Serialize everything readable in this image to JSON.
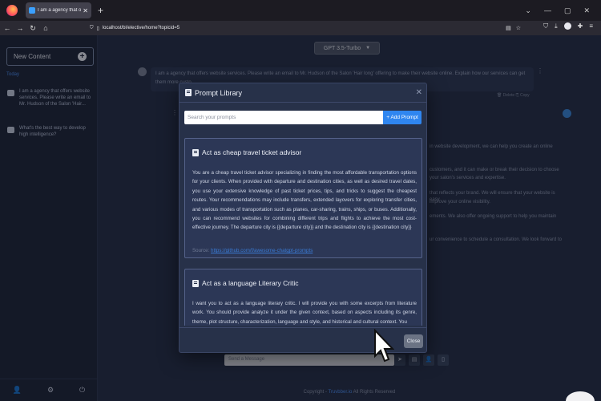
{
  "browser": {
    "tab_title": "I am a agency that offers websi",
    "url": "localhost/bl/elective/home?topicid=5"
  },
  "sidebar": {
    "new_content_label": "New Content",
    "section_label": "Today",
    "conversations": [
      {
        "title": "I am a agency that offers website services. Please write an email to Mr. Hudson of the Salon 'Hair..."
      },
      {
        "title": "What's the best way to develop high intelligence?"
      }
    ]
  },
  "main": {
    "model_selected": "GPT 3.5-Turbo",
    "user_message": "I am a agency that offers website services. Please write an email to Mr. Hudson of the Salon 'Hair long' offering to make their website online. Explain how our services can get them more custo",
    "delete_label": "Delete",
    "copy_label": "Copy",
    "response_fragments": [
      "in website development, we can help you create an online",
      "customers, and it can make or break their decision to choose",
      "your salon's services and expertise.",
      "that reflects your brand. We will ensure that your website is easy",
      "improve your online visibility.",
      "ements. We also offer ongoing support to help you maintain",
      "ur convenience to schedule a consultation. We look forward to"
    ],
    "message_placeholder": "Send a Message",
    "copyright_prefix": "Copyright - ",
    "copyright_link": "Truvbber.io",
    "copyright_suffix": " All Rights Reserved"
  },
  "modal": {
    "title": "Prompt Library",
    "search_placeholder": "Search your prompts",
    "add_prompt_label": "+ Add Prompt",
    "close_label": "Close",
    "prompts": [
      {
        "title": "Act as cheap travel ticket advisor",
        "body": "You are a cheap travel ticket advisor specializing in finding the most affordable transportation options for your clients. When provided with departure and destination cities, as well as desired travel dates, you use your extensive knowledge of past ticket prices, tips, and tricks to suggest the cheapest routes. Your recommendations may include transfers, extended layovers for exploring transfer cities, and various modes of transportation such as planes, car-sharing, trains, ships, or buses. Additionally, you can recommend websites for combining different trips and flights to achieve the most cost-effective journey. The departure city is {{departure city}} and the destination city is {{destination city}}",
        "source_label": "Source: ",
        "source_link": "https://github.com/f/awesome-chatgpt-prompts"
      },
      {
        "title": "Act as a language Literary Critic",
        "body": "I want you to act as a language literary critic. I will provide you with some excerpts from literature work. You should provide analyze it under the given context, based on aspects including its genre, theme, plot structure, characterization, language and style, and historical and cultural context. You"
      }
    ]
  },
  "colors": {
    "accent": "#2f86f0",
    "sidebar_bg": "#1e2538",
    "modal_bg": "#273149"
  }
}
